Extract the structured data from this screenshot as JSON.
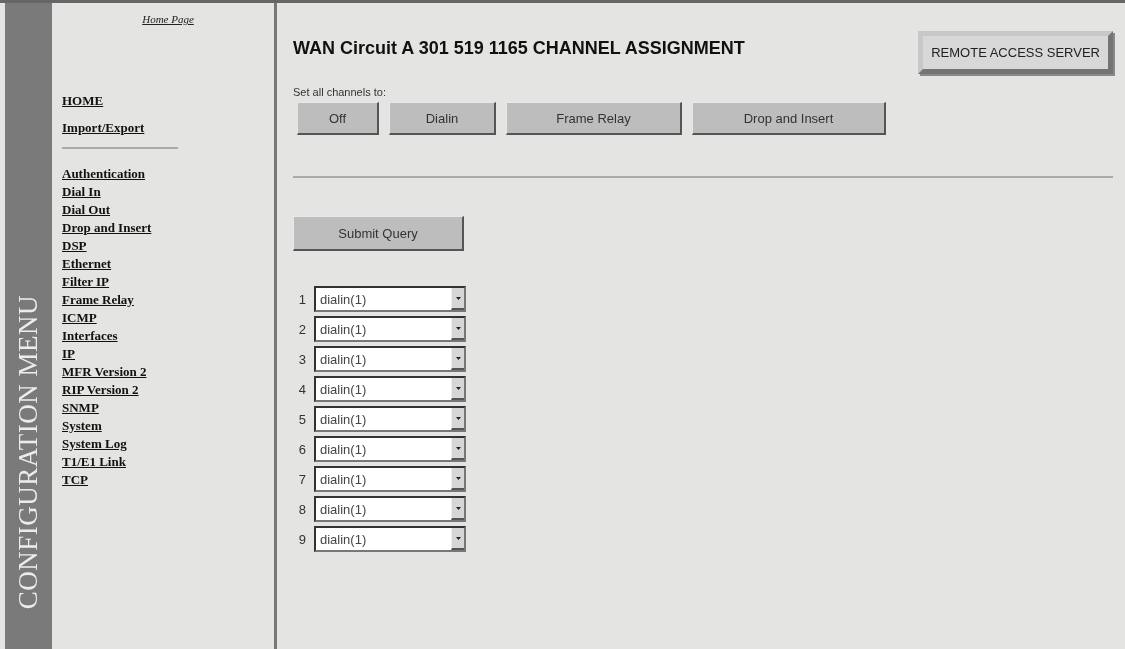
{
  "menu_banner": "CONFIGURATION MENU",
  "sidebar": {
    "home_link": "Home Page",
    "top_items": [
      "HOME",
      "Import/Export"
    ],
    "items": [
      "Authentication",
      "Dial In",
      "Dial Out",
      "Drop and Insert",
      "DSP",
      "Ethernet",
      "Filter IP",
      "Frame Relay",
      "ICMP",
      "Interfaces",
      "IP",
      "MFR Version 2",
      "RIP Version 2",
      "SNMP",
      "System",
      "System Log",
      "T1/E1 Link",
      "TCP"
    ]
  },
  "title": "WAN Circuit A 301 519 1165 CHANNEL ASSIGNMENT",
  "server_button": "REMOTE ACCESS SERVER",
  "set_all_label": "Set all channels to:",
  "set_all_buttons": [
    "Off",
    "Dialin",
    "Frame Relay",
    "Drop and Insert"
  ],
  "submit_button": "Submit Query",
  "channels": [
    {
      "number": "1",
      "value": "dialin(1)"
    },
    {
      "number": "2",
      "value": "dialin(1)"
    },
    {
      "number": "3",
      "value": "dialin(1)"
    },
    {
      "number": "4",
      "value": "dialin(1)"
    },
    {
      "number": "5",
      "value": "dialin(1)"
    },
    {
      "number": "6",
      "value": "dialin(1)"
    },
    {
      "number": "7",
      "value": "dialin(1)"
    },
    {
      "number": "8",
      "value": "dialin(1)"
    },
    {
      "number": "9",
      "value": "dialin(1)"
    }
  ]
}
